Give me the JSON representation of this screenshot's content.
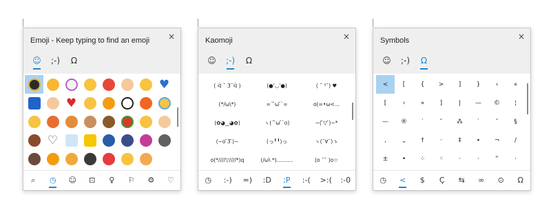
{
  "panels": [
    {
      "title": "Emoji - Keep typing to find an emoji",
      "close": "×",
      "tabs": [
        {
          "glyph": "☺",
          "name": "emoji"
        },
        {
          "glyph": ";-)",
          "name": "kaomoji"
        },
        {
          "glyph": "Ω",
          "name": "symbols"
        }
      ],
      "active_tab": 0,
      "emoji_icons": [
        "sun-face-icon",
        "grinning-tongue-icon",
        "unicorn-icon",
        "grinning-face-icon",
        "alarm-clock-icon",
        "thumbs-up-icon",
        "smiling-face-icon",
        "blue-heart-icon",
        "new-button-icon",
        "pointing-hand-icon",
        "red-heart-icon",
        "relieved-face-icon",
        "hushed-face-icon",
        "eyes-icon",
        "fire-icon",
        "crying-face-icon",
        "thinking-face-icon",
        "peach-icon",
        "planet-icon",
        "clapping-hands-icon",
        "flexed-arm-icon",
        "hot-pepper-icon",
        "beaming-face-icon",
        "pointing-right-icon",
        "arm-icon",
        "white-heart-icon",
        "ice-cube-icon",
        "yellow-square-icon",
        "car-icon",
        "stethoscope-icon",
        "pink-blob-icon",
        "swan-icon",
        "muscle-icon",
        "sweat-face-icon",
        "cake-icon",
        "laptop-icon",
        "siren-icon",
        "smiling-face-2-icon",
        "cat-face-icon"
      ],
      "bottom_tabs": [
        {
          "glyph": "⌕",
          "name": "search"
        },
        {
          "glyph": "◷",
          "name": "recent"
        },
        {
          "glyph": "☺",
          "name": "smileys"
        },
        {
          "glyph": "⊡",
          "name": "people"
        },
        {
          "glyph": "♀",
          "name": "celebration"
        },
        {
          "glyph": "⚐",
          "name": "food"
        },
        {
          "glyph": "⚙",
          "name": "transport"
        },
        {
          "glyph": "♡",
          "name": "hearts"
        }
      ],
      "bottom_active": 1
    },
    {
      "title": "Kaomoji",
      "close": "×",
      "tabs": [
        {
          "glyph": "☺",
          "name": "emoji"
        },
        {
          "glyph": ";-)",
          "name": "kaomoji"
        },
        {
          "glyph": "Ω",
          "name": "symbols"
        }
      ],
      "active_tab": 1,
      "kaomoji": [
        "( ᐛ ˘ 3˘ᐛ )",
        "(●'◡'●)",
        "( ˘ ³˘) ♥",
        "(*/ω\\*)",
        "=´ ̄ω ̄`=",
        "o(=•ω<...",
        "(✿◕‿◕✿)",
        "ヽ(´ ̄ω ̄`o)",
        "~( ̄▽ ̄)~*",
        "(~o ̄3 ̄)~",
        "(っ╹╹)っ",
        "ヽ(¯∀¯)ゝ",
        "o(*////▽////*)q",
        "(/ω\\ *)..........",
        "(o ˘˘ )o☆"
      ],
      "bottom_tabs": [
        {
          "glyph": "◷",
          "name": "recent"
        },
        {
          "glyph": ":-)",
          "name": "classic"
        },
        {
          "glyph": "=)",
          "name": "happy"
        },
        {
          "glyph": ":D",
          "name": "laughing"
        },
        {
          "glyph": ";P",
          "name": "wink"
        },
        {
          "glyph": ":-(",
          "name": "sad"
        },
        {
          "glyph": ">:(",
          "name": "angry"
        },
        {
          "glyph": ":-0",
          "name": "surprised"
        }
      ],
      "bottom_active": 4
    },
    {
      "title": "Symbols",
      "close": "×",
      "tabs": [
        {
          "glyph": "☺",
          "name": "emoji"
        },
        {
          "glyph": ";-)",
          "name": "kaomoji"
        },
        {
          "glyph": "Ω",
          "name": "symbols"
        }
      ],
      "active_tab": 2,
      "symbols": [
        "<",
        "[",
        "{",
        ">",
        "]",
        "}",
        "‹",
        "«",
        "⁅",
        "›",
        "»",
        "⁆",
        "|",
        "—",
        "©",
        "¦",
        "—",
        "®",
        "′",
        "″",
        "⁂",
        "′",
        "″",
        "§",
        ",",
        "„",
        "†",
        "·",
        "‡",
        "∙",
        "¬",
        "/",
        "±",
        "•",
        "⁘",
        "⁖",
        "·",
        "·",
        "‟",
        "·"
      ],
      "selected_symbol": 0,
      "bottom_tabs": [
        {
          "glyph": "◷",
          "name": "recent"
        },
        {
          "glyph": "<",
          "name": "punctuation"
        },
        {
          "glyph": "$",
          "name": "currency"
        },
        {
          "glyph": "Ç",
          "name": "latin"
        },
        {
          "glyph": "⇆",
          "name": "geometric"
        },
        {
          "glyph": "∞",
          "name": "math"
        },
        {
          "glyph": "⊙",
          "name": "supplemental"
        },
        {
          "glyph": "Ω",
          "name": "language"
        }
      ],
      "bottom_active": 1
    }
  ],
  "colors": {
    "accent": "#1a86d0",
    "selected_cell": "#a9d2f0",
    "header_bg": "#efefef"
  }
}
